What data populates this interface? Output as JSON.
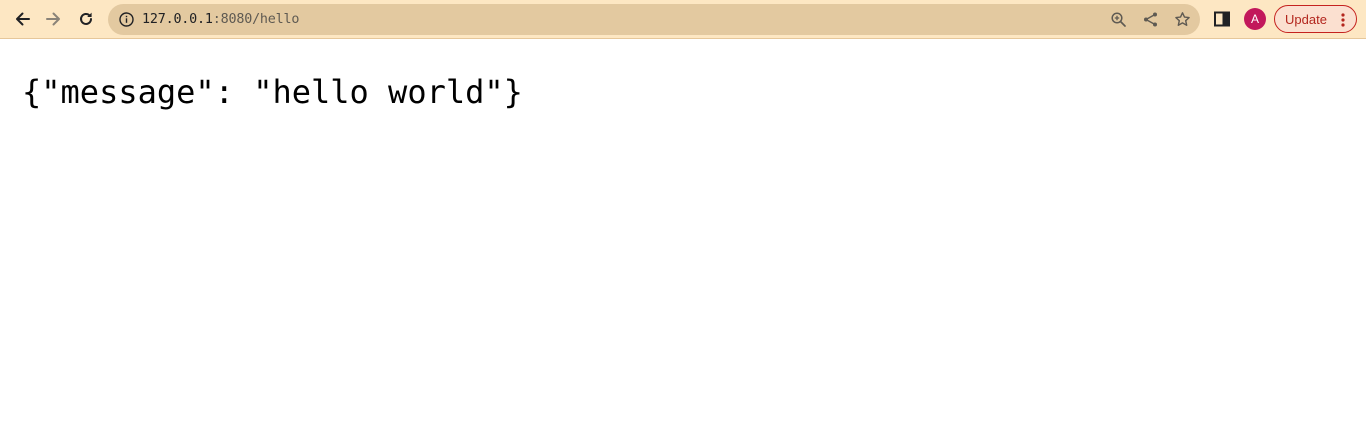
{
  "browser": {
    "address_bar": {
      "host": "127.0.0.1",
      "path": ":8080/hello"
    },
    "icons": {
      "back": "back-arrow-icon",
      "forward": "forward-arrow-icon",
      "reload": "reload-icon",
      "site_info": "info-icon",
      "zoom": "zoom-icon",
      "share": "share-icon",
      "bookmark": "star-icon",
      "side_panel": "side-panel-icon",
      "menu": "more-vertical-icon"
    },
    "profile": {
      "initial": "A",
      "color": "#c2185b"
    },
    "update_button": {
      "label": "Update",
      "color": "#c5221f"
    },
    "toolbar_color": "#fde7c3"
  },
  "page": {
    "body_text": "{\"message\": \"hello world\"}"
  }
}
